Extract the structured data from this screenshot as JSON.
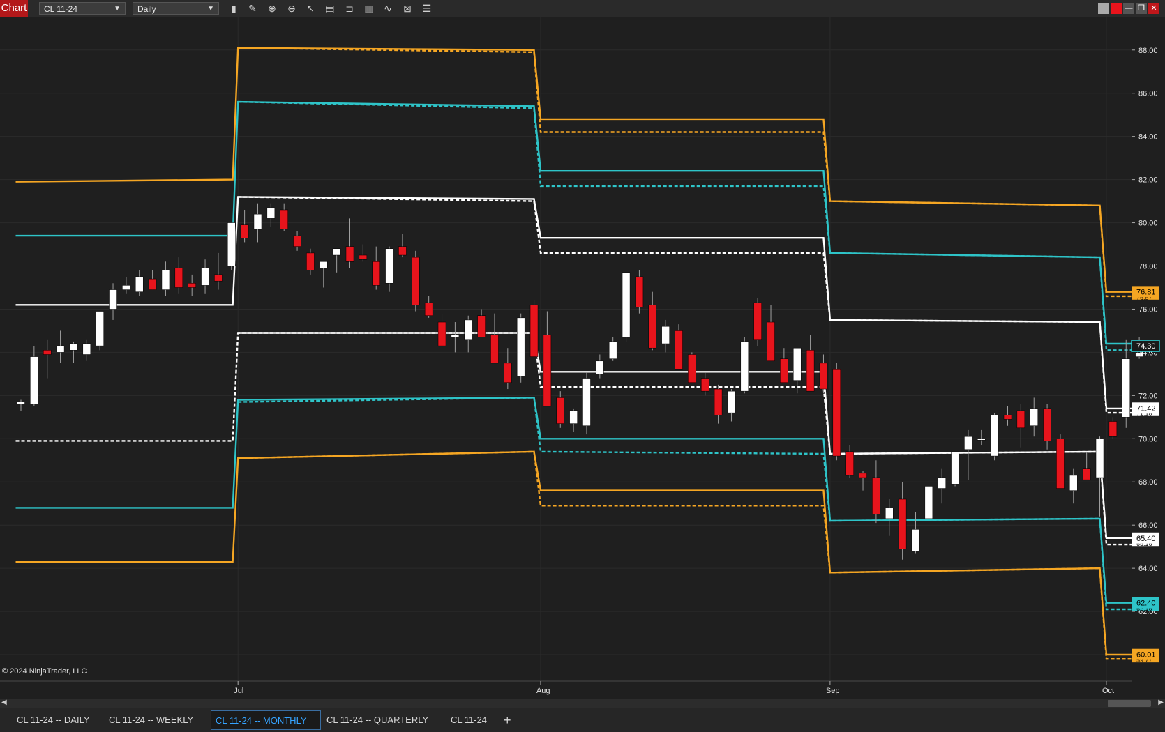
{
  "toolbar": {
    "chart_label": "Chart",
    "instrument": "CL 11-24",
    "interval": "Daily",
    "tools": [
      "bars-icon",
      "pencil-icon",
      "zoom-in-icon",
      "zoom-out-icon",
      "pointer-icon",
      "data-box-icon",
      "range-icon",
      "chart-trader-icon",
      "indicators-icon",
      "strategies-icon",
      "properties-icon"
    ]
  },
  "window_buttons": [
    "grey-button",
    "red-button",
    "minimize-icon",
    "restore-icon",
    "close-icon"
  ],
  "chart_data": {
    "type": "candlestick",
    "instrument": "CL 11-24",
    "period": "Daily",
    "y_ticks": [
      "88.00",
      "86.00",
      "84.00",
      "82.00",
      "80.00",
      "78.00",
      "76.00",
      "74.00",
      "72.00",
      "70.00",
      "68.00",
      "66.00",
      "64.00",
      "62.00",
      "60.00"
    ],
    "ylim": [
      59.0,
      88.8
    ],
    "x_ticks": [
      {
        "label": "Jul",
        "bar": 16.5
      },
      {
        "label": "Aug",
        "bar": 39.5
      },
      {
        "label": "Sep",
        "bar": 61.5
      },
      {
        "label": "Oct",
        "bar": 82.5
      }
    ],
    "candles": [
      [
        71.6,
        71.8,
        71.3,
        71.7
      ],
      [
        71.6,
        74.3,
        71.5,
        73.8
      ],
      [
        74.1,
        74.6,
        72.8,
        73.9
      ],
      [
        74.0,
        75.0,
        73.5,
        74.3
      ],
      [
        74.1,
        74.5,
        73.5,
        74.4
      ],
      [
        73.9,
        74.6,
        73.6,
        74.4
      ],
      [
        74.3,
        75.8,
        74.1,
        75.9
      ],
      [
        76.0,
        77.2,
        75.5,
        76.9
      ],
      [
        76.9,
        77.5,
        76.7,
        77.1
      ],
      [
        76.8,
        77.8,
        76.6,
        77.5
      ],
      [
        77.4,
        77.8,
        76.9,
        76.9
      ],
      [
        76.9,
        78.2,
        76.6,
        77.8
      ],
      [
        77.9,
        78.4,
        76.7,
        77.0
      ],
      [
        77.2,
        77.6,
        76.6,
        77.0
      ],
      [
        77.1,
        78.3,
        76.7,
        77.9
      ],
      [
        77.6,
        78.6,
        76.9,
        77.3
      ],
      [
        78.0,
        80.0,
        77.8,
        80.0
      ],
      [
        79.9,
        80.6,
        79.1,
        79.3
      ],
      [
        79.7,
        80.9,
        79.1,
        80.4
      ],
      [
        80.2,
        80.9,
        79.8,
        80.7
      ],
      [
        80.6,
        80.9,
        79.6,
        79.7
      ],
      [
        79.4,
        79.6,
        78.7,
        78.9
      ],
      [
        78.6,
        78.8,
        77.6,
        77.8
      ],
      [
        77.9,
        78.1,
        77.0,
        78.2
      ],
      [
        78.5,
        78.8,
        77.7,
        78.8
      ],
      [
        78.9,
        80.2,
        77.9,
        78.2
      ],
      [
        78.5,
        79.0,
        78.2,
        78.3
      ],
      [
        78.2,
        78.9,
        76.9,
        77.1
      ],
      [
        77.2,
        78.9,
        76.8,
        78.8
      ],
      [
        78.9,
        79.5,
        78.4,
        78.5
      ],
      [
        78.4,
        78.7,
        75.9,
        76.2
      ],
      [
        76.3,
        76.6,
        75.6,
        75.7
      ],
      [
        75.4,
        75.8,
        74.5,
        74.3
      ],
      [
        74.7,
        75.4,
        74.0,
        74.8
      ],
      [
        74.6,
        75.7,
        74.0,
        75.5
      ],
      [
        75.7,
        76.0,
        74.7,
        74.7
      ],
      [
        74.8,
        75.8,
        73.7,
        73.5
      ],
      [
        73.5,
        74.2,
        72.3,
        72.6
      ],
      [
        72.9,
        75.8,
        72.6,
        75.6
      ],
      [
        76.2,
        76.4,
        73.8,
        73.8
      ],
      [
        74.8,
        75.9,
        71.7,
        71.5
      ],
      [
        71.9,
        72.2,
        70.5,
        70.7
      ],
      [
        70.7,
        71.4,
        70.3,
        71.3
      ],
      [
        70.6,
        73.1,
        70.2,
        72.8
      ],
      [
        73.0,
        73.9,
        72.8,
        73.6
      ],
      [
        73.7,
        74.7,
        73.6,
        74.5
      ],
      [
        74.7,
        77.7,
        74.5,
        77.7
      ],
      [
        77.5,
        77.8,
        75.8,
        76.1
      ],
      [
        76.2,
        76.8,
        74.1,
        74.2
      ],
      [
        74.4,
        75.5,
        74.0,
        75.2
      ],
      [
        75.0,
        75.3,
        73.2,
        73.2
      ],
      [
        73.9,
        74.0,
        72.6,
        72.6
      ],
      [
        72.8,
        73.1,
        72.0,
        72.2
      ],
      [
        72.3,
        72.5,
        70.7,
        71.1
      ],
      [
        71.2,
        72.3,
        70.8,
        72.2
      ],
      [
        72.2,
        74.7,
        72.1,
        74.5
      ],
      [
        76.3,
        76.5,
        74.3,
        74.6
      ],
      [
        75.4,
        76.2,
        73.6,
        73.6
      ],
      [
        73.7,
        74.2,
        72.6,
        72.6
      ],
      [
        72.7,
        73.5,
        72.1,
        74.2
      ],
      [
        74.1,
        74.8,
        72.3,
        72.2
      ],
      [
        73.5,
        73.9,
        72.1,
        72.3
      ],
      [
        73.2,
        73.5,
        69.0,
        69.2
      ],
      [
        69.4,
        69.7,
        68.2,
        68.3
      ],
      [
        68.4,
        68.5,
        67.6,
        68.2
      ],
      [
        68.2,
        69.0,
        66.1,
        66.5
      ],
      [
        66.3,
        67.2,
        65.5,
        66.8
      ],
      [
        67.2,
        68.0,
        64.4,
        64.9
      ],
      [
        64.8,
        66.6,
        64.7,
        65.8
      ],
      [
        66.3,
        67.6,
        66.3,
        67.8
      ],
      [
        67.7,
        68.6,
        67.0,
        68.2
      ],
      [
        67.9,
        69.1,
        67.8,
        69.4
      ],
      [
        69.5,
        70.4,
        68.1,
        70.1
      ],
      [
        70.0,
        70.4,
        69.7,
        70.0
      ],
      [
        69.2,
        71.2,
        69.0,
        71.1
      ],
      [
        71.1,
        71.5,
        70.6,
        70.9
      ],
      [
        71.3,
        71.6,
        69.6,
        70.5
      ],
      [
        70.6,
        71.9,
        70.1,
        71.4
      ],
      [
        71.4,
        71.6,
        69.5,
        69.9
      ],
      [
        70.0,
        70.2,
        67.8,
        67.7
      ],
      [
        67.6,
        68.6,
        67.0,
        68.3
      ],
      [
        68.6,
        69.4,
        68.1,
        68.1
      ],
      [
        68.2,
        70.1,
        66.4,
        70.0
      ],
      [
        70.8,
        71.0,
        70.0,
        70.1
      ],
      [
        71.0,
        74.6,
        70.5,
        73.7
      ],
      [
        73.8,
        74.7,
        73.7,
        74.5
      ]
    ],
    "levels": [
      {
        "color": "#f5a623",
        "style": "solid",
        "steps": [
          [
            -0.4,
            81.9
          ],
          [
            16.1,
            82.0
          ],
          [
            16.5,
            88.1
          ],
          [
            39.0,
            88.0
          ],
          [
            39.5,
            84.8
          ],
          [
            61.0,
            84.8
          ],
          [
            61.5,
            81.0
          ],
          [
            82.0,
            80.8
          ],
          [
            82.5,
            76.8
          ],
          [
            86.5,
            76.8
          ]
        ]
      },
      {
        "color": "#f5a623",
        "style": "dashed",
        "steps": [
          [
            16.5,
            88.1
          ],
          [
            39.0,
            87.9
          ],
          [
            39.5,
            84.2
          ],
          [
            61.0,
            84.2
          ],
          [
            61.5,
            81.0
          ],
          [
            82.0,
            80.8
          ],
          [
            82.5,
            76.6
          ],
          [
            86.5,
            76.6
          ]
        ]
      },
      {
        "color": "#2ec4c8",
        "style": "solid",
        "steps": [
          [
            -0.4,
            79.4
          ],
          [
            16.1,
            79.4
          ],
          [
            16.5,
            85.6
          ],
          [
            39.0,
            85.4
          ],
          [
            39.5,
            82.4
          ],
          [
            61.0,
            82.4
          ],
          [
            61.5,
            78.6
          ],
          [
            82.0,
            78.4
          ],
          [
            82.5,
            74.4
          ],
          [
            86.5,
            74.4
          ]
        ]
      },
      {
        "color": "#2ec4c8",
        "style": "dashed",
        "steps": [
          [
            16.5,
            85.6
          ],
          [
            39.0,
            85.3
          ],
          [
            39.5,
            81.7
          ],
          [
            61.0,
            81.7
          ],
          [
            61.5,
            78.6
          ],
          [
            82.0,
            78.4
          ],
          [
            82.5,
            74.1
          ],
          [
            86.5,
            74.1
          ]
        ]
      },
      {
        "color": "#ffffff",
        "style": "solid",
        "steps": [
          [
            -0.4,
            76.2
          ],
          [
            16.1,
            76.2
          ],
          [
            16.5,
            81.2
          ],
          [
            39.0,
            81.1
          ],
          [
            39.5,
            79.3
          ],
          [
            61.0,
            79.3
          ],
          [
            61.5,
            75.5
          ],
          [
            82.0,
            75.4
          ],
          [
            82.5,
            71.4
          ],
          [
            86.5,
            71.4
          ]
        ]
      },
      {
        "color": "#ffffff",
        "style": "dashed",
        "steps": [
          [
            16.5,
            81.2
          ],
          [
            39.0,
            81.0
          ],
          [
            39.5,
            78.6
          ],
          [
            61.0,
            78.6
          ],
          [
            61.5,
            75.5
          ],
          [
            82.0,
            75.4
          ],
          [
            82.5,
            71.2
          ],
          [
            86.5,
            71.2
          ]
        ]
      },
      {
        "color": "#ffffff",
        "style": "solid",
        "steps": [
          [
            16.5,
            74.9
          ],
          [
            39.0,
            74.9
          ],
          [
            39.5,
            73.1
          ],
          [
            61.0,
            73.1
          ],
          [
            61.5,
            69.3
          ],
          [
            82.0,
            69.4
          ],
          [
            82.5,
            65.4
          ],
          [
            86.5,
            65.4
          ]
        ]
      },
      {
        "color": "#ffffff",
        "style": "dashed",
        "steps": [
          [
            -0.4,
            69.9
          ],
          [
            16.1,
            69.9
          ],
          [
            16.5,
            74.9
          ],
          [
            39.0,
            74.9
          ],
          [
            39.5,
            72.4
          ],
          [
            61.0,
            72.4
          ],
          [
            61.5,
            69.3
          ],
          [
            82.0,
            69.4
          ],
          [
            82.5,
            65.1
          ],
          [
            86.5,
            65.1
          ]
        ]
      },
      {
        "color": "#2ec4c8",
        "style": "solid",
        "steps": [
          [
            -0.4,
            66.8
          ],
          [
            16.1,
            66.8
          ],
          [
            16.5,
            71.8
          ],
          [
            39.0,
            71.9
          ],
          [
            39.5,
            70.0
          ],
          [
            61.0,
            70.0
          ],
          [
            61.5,
            66.2
          ],
          [
            82.0,
            66.3
          ],
          [
            82.5,
            62.4
          ],
          [
            86.5,
            62.4
          ]
        ]
      },
      {
        "color": "#2ec4c8",
        "style": "dashed",
        "steps": [
          [
            16.5,
            71.7
          ],
          [
            39.0,
            71.9
          ],
          [
            39.5,
            69.4
          ],
          [
            61.0,
            69.3
          ],
          [
            61.5,
            66.2
          ],
          [
            82.0,
            66.3
          ],
          [
            82.5,
            62.1
          ],
          [
            86.5,
            62.1
          ]
        ]
      },
      {
        "color": "#f5a623",
        "style": "solid",
        "steps": [
          [
            -0.4,
            64.3
          ],
          [
            16.1,
            64.3
          ],
          [
            16.5,
            69.1
          ],
          [
            39.0,
            69.4
          ],
          [
            39.5,
            67.6
          ],
          [
            61.0,
            67.6
          ],
          [
            61.5,
            63.8
          ],
          [
            82.0,
            64.0
          ],
          [
            82.5,
            60.0
          ],
          [
            86.5,
            60.0
          ]
        ]
      },
      {
        "color": "#f5a623",
        "style": "dashed",
        "steps": [
          [
            16.5,
            69.1
          ],
          [
            39.0,
            69.4
          ],
          [
            39.5,
            66.9
          ],
          [
            61.0,
            66.9
          ],
          [
            61.5,
            63.8
          ],
          [
            82.0,
            64.0
          ],
          [
            82.5,
            59.8
          ],
          [
            86.5,
            59.8
          ]
        ]
      }
    ],
    "price_labels": [
      {
        "value": "76.81",
        "price": 76.81,
        "bg": "#f5a623",
        "fg": "#000000",
        "sub": "76.57",
        "sub_price": 76.57
      },
      {
        "value": "74.30",
        "price": 74.3,
        "bg": "#1a1a1a",
        "fg": "#ffffff",
        "border": "#2ec4c8",
        "sub": "74.08",
        "sub_price": 74.08
      },
      {
        "value": "71.42",
        "price": 71.42,
        "bg": "#ffffff",
        "fg": "#000000",
        "sub": "71.18",
        "sub_price": 71.18
      },
      {
        "value": "65.40",
        "price": 65.4,
        "bg": "#ffffff",
        "fg": "#000000",
        "sub": "65.16",
        "sub_price": 65.16
      },
      {
        "value": "62.40",
        "price": 62.4,
        "bg": "#2ec4c8",
        "fg": "#000000",
        "sub": "62.16",
        "sub_price": 62.16
      },
      {
        "value": "60.01",
        "price": 60.01,
        "bg": "#f5a623",
        "fg": "#000000",
        "sub": "59.77",
        "sub_price": 59.77
      }
    ],
    "up_color": "#ffffff",
    "down_color": "#e8141c"
  },
  "copyright": "© 2024 NinjaTrader, LLC",
  "tabs": [
    {
      "label": "CL 11-24 -- DAILY",
      "active": false
    },
    {
      "label": "CL 11-24 -- WEEKLY",
      "active": false
    },
    {
      "label": "CL 11-24 -- MONTHLY",
      "active": true
    },
    {
      "label": "CL 11-24 -- QUARTERLY",
      "active": false
    },
    {
      "label": "CL 11-24",
      "active": false
    }
  ],
  "add_tab": "+"
}
